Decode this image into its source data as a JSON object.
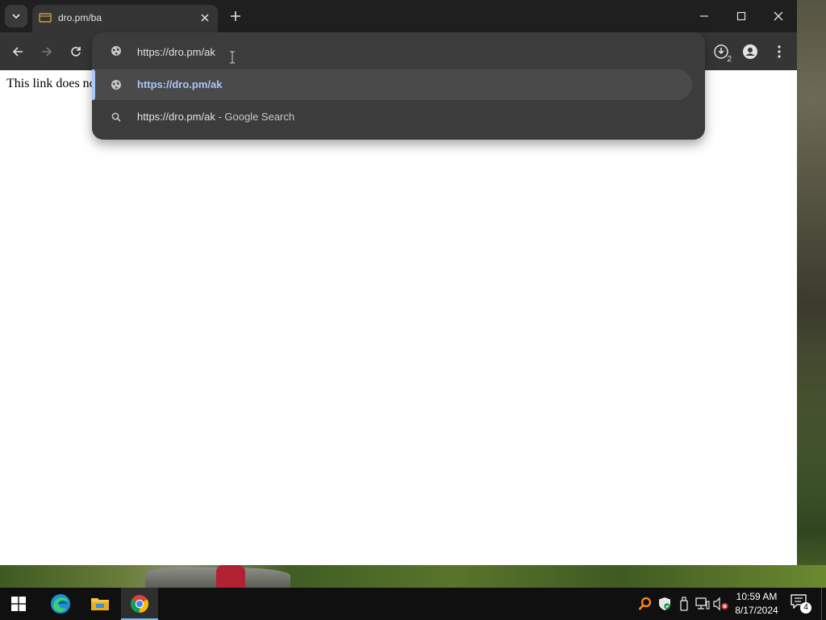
{
  "browser": {
    "tab": {
      "title": "dro.pm/ba"
    },
    "downloads_count": "2",
    "omnibox": {
      "value": "https://dro.pm/ak",
      "suggestions": [
        {
          "text": "https://dro.pm/ak",
          "suffix": "",
          "icon": "globe-icon",
          "selected": true
        },
        {
          "text": "https://dro.pm/ak",
          "suffix": " - Google Search",
          "icon": "search-icon",
          "selected": false
        }
      ]
    },
    "page_text": "This link does no",
    "colors": {
      "accent": "#a8c7fa",
      "toolbar": "#353535",
      "titlebar": "#1f1f1f",
      "dropdown": "#3c3c3c"
    }
  },
  "taskbar": {
    "pinned": [
      {
        "name": "start-button",
        "icon": "windows-logo-icon"
      },
      {
        "name": "edge-button",
        "icon": "edge-icon"
      },
      {
        "name": "file-explorer-button",
        "icon": "folder-icon"
      },
      {
        "name": "chrome-button",
        "icon": "chrome-icon",
        "active": true
      }
    ],
    "time": "10:59 AM",
    "date": "8/17/2024",
    "notification_count": "4"
  }
}
